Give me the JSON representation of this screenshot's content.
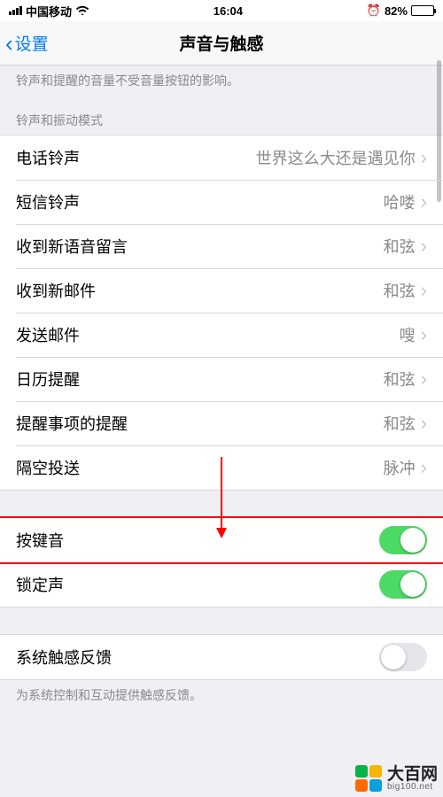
{
  "status": {
    "carrier": "中国移动",
    "time": "16:04",
    "battery_pct": "82%"
  },
  "nav": {
    "back_label": "设置",
    "title": "声音与触感"
  },
  "subtext_top": "铃声和提醒的音量不受音量按钮的影响。",
  "section_header_ringtone": "铃声和振动模式",
  "sounds": [
    {
      "label": "电话铃声",
      "value": "世界这么大还是遇见你"
    },
    {
      "label": "短信铃声",
      "value": "哈喽"
    },
    {
      "label": "收到新语音留言",
      "value": "和弦"
    },
    {
      "label": "收到新邮件",
      "value": "和弦"
    },
    {
      "label": "发送邮件",
      "value": "嗖"
    },
    {
      "label": "日历提醒",
      "value": "和弦"
    },
    {
      "label": "提醒事项的提醒",
      "value": "和弦"
    },
    {
      "label": "隔空投送",
      "value": "脉冲"
    }
  ],
  "toggles_group1": [
    {
      "label": "按键音",
      "on": true,
      "highlight": true
    },
    {
      "label": "锁定声",
      "on": true,
      "highlight": false
    }
  ],
  "toggles_group2": [
    {
      "label": "系统触感反馈",
      "on": false
    }
  ],
  "footer_text": "为系统控制和互动提供触感反馈。",
  "watermark": {
    "cn": "大百网",
    "en": "big100.net",
    "colors": [
      "#09b24a",
      "#f7b500",
      "#ff6a00",
      "#0aa1dd"
    ]
  }
}
